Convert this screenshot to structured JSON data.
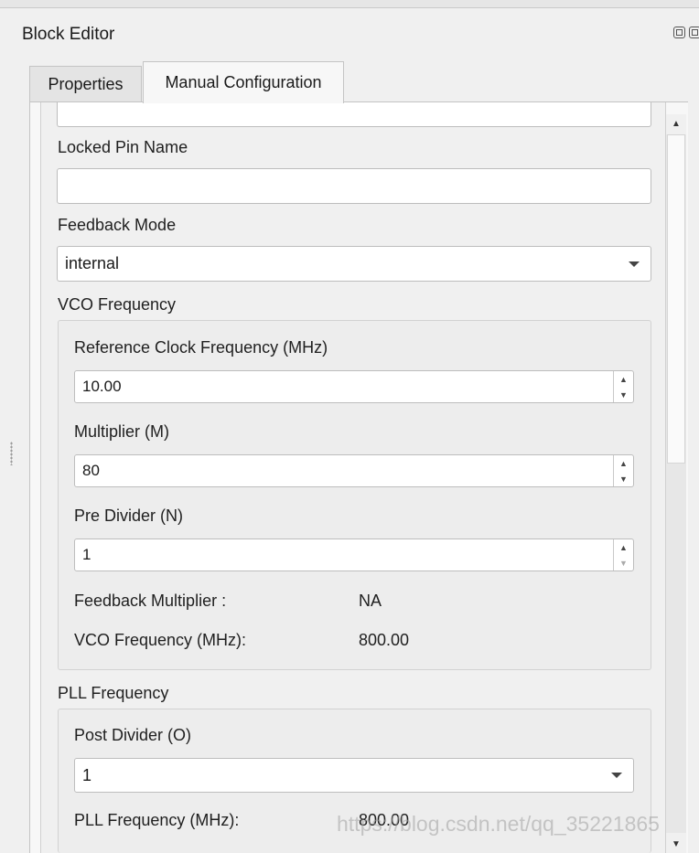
{
  "window": {
    "title": "Block Editor"
  },
  "tabs": [
    {
      "label": "Properties",
      "active": false
    },
    {
      "label": "Manual Configuration",
      "active": true
    }
  ],
  "fields": {
    "locked_pin_name": {
      "label": "Locked Pin Name",
      "value": ""
    },
    "feedback_mode": {
      "label": "Feedback Mode",
      "value": "internal"
    }
  },
  "vco_group": {
    "title": "VCO Frequency",
    "ref_clock": {
      "label": "Reference Clock Frequency (MHz)",
      "value": "10.00"
    },
    "multiplier": {
      "label": "Multiplier (M)",
      "value": "80"
    },
    "pre_divider": {
      "label": "Pre Divider (N)",
      "value": "1"
    },
    "feedback_multiplier": {
      "label": "Feedback Multiplier :",
      "value": "NA"
    },
    "vco_frequency": {
      "label": "VCO Frequency (MHz):",
      "value": "800.00"
    }
  },
  "pll_group": {
    "title": "PLL Frequency",
    "post_divider": {
      "label": "Post Divider (O)",
      "value": "1"
    },
    "pll_frequency": {
      "label": "PLL Frequency (MHz):",
      "value": "800.00"
    }
  },
  "watermark": "https://blog.csdn.net/qq_35221865"
}
